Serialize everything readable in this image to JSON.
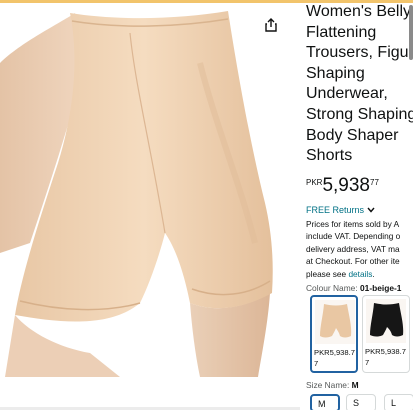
{
  "product": {
    "title": "Women's Belly\nFlattening\nTrousers, Figure\nShaping\nUnderwear,\nStrong Shaping\nBody Shaper\nShorts",
    "price_currency": "PKR",
    "price_whole": "5,938",
    "price_fraction": "77"
  },
  "returns": {
    "label": "FREE Returns"
  },
  "vat": {
    "text": "Prices for items sold by A\ninclude VAT. Depending o\ndelivery address, VAT ma\nat Checkout. For other ite\nplease see ",
    "link": "details",
    "end": "."
  },
  "colour": {
    "label": "Colour Name: ",
    "value": "01-beige-1"
  },
  "swatches": [
    {
      "price": "PKR5,938.7\n7",
      "color": "#e9c7a3"
    },
    {
      "price": "PKR5,938.7\n7",
      "color": "#161616"
    }
  ],
  "size": {
    "label": "Size Name: ",
    "value": "M",
    "options": [
      "M",
      "S",
      "L"
    ]
  },
  "colors": {
    "link": "#007185",
    "selected_border": "#2162a1",
    "skin_garment": "#f1d3b1"
  },
  "icons": {
    "share": "share-icon",
    "chevron": "chevron-down-icon"
  }
}
